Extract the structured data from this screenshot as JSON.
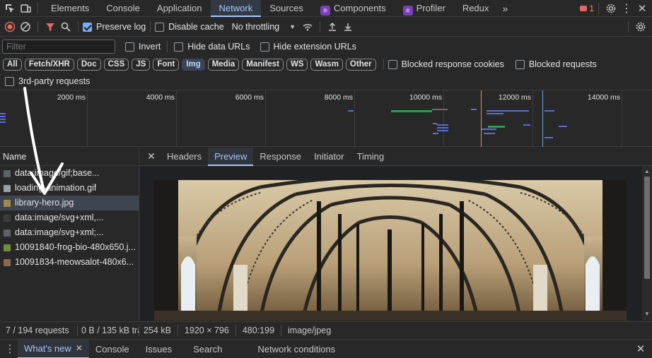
{
  "tabs": [
    "Elements",
    "Console",
    "Application",
    "Network",
    "Sources",
    "Components",
    "Profiler",
    "Redux"
  ],
  "error_count": "1",
  "toolbar": {
    "preserve_log": "Preserve log",
    "disable_cache": "Disable cache",
    "throttling": "No throttling"
  },
  "filter": {
    "placeholder": "Filter",
    "invert": "Invert",
    "hide_data_urls": "Hide data URLs",
    "hide_extension_urls": "Hide extension URLs"
  },
  "types": [
    "All",
    "Fetch/XHR",
    "Doc",
    "CSS",
    "JS",
    "Font",
    "Img",
    "Media",
    "Manifest",
    "WS",
    "Wasm",
    "Other"
  ],
  "active_type": "Img",
  "blocked_response_cookies": "Blocked response cookies",
  "blocked_requests": "Blocked requests",
  "third_party": "3rd-party requests",
  "timeline_ticks": [
    "2000 ms",
    "4000 ms",
    "6000 ms",
    "8000 ms",
    "10000 ms",
    "12000 ms",
    "14000 ms"
  ],
  "name_header": "Name",
  "requests": [
    {
      "name": "data:image/gif;base...",
      "icon_color": "#5f6368"
    },
    {
      "name": "loading-animation.gif",
      "icon_color": "#9aa0a6"
    },
    {
      "name": "library-hero.jpg",
      "icon_color": "#a08a4a"
    },
    {
      "name": "data:image/svg+xml,...",
      "icon_color": "#3b3b3b"
    },
    {
      "name": "data:image/svg+xml;...",
      "icon_color": "#5f6368"
    },
    {
      "name": "10091840-frog-bio-480x650.j...",
      "icon_color": "#6b8f3a"
    },
    {
      "name": "10091834-meowsalot-480x6...",
      "icon_color": "#8a6a4a"
    }
  ],
  "detail_tabs": [
    "Headers",
    "Preview",
    "Response",
    "Initiator",
    "Timing"
  ],
  "active_detail_tab": "Preview",
  "status": {
    "requests": "7 / 194 requests",
    "transferred": "0 B / 135 kB tra",
    "size": "254 kB",
    "dimensions": "1920 × 796",
    "rendered": "480:199",
    "mime": "image/jpeg"
  },
  "drawer_tabs": [
    "What's new",
    "Console",
    "Issues",
    "Search",
    "Network conditions"
  ],
  "colors": {
    "accent": "#a8c7fa",
    "background": "#282828",
    "record": "#e46962"
  }
}
